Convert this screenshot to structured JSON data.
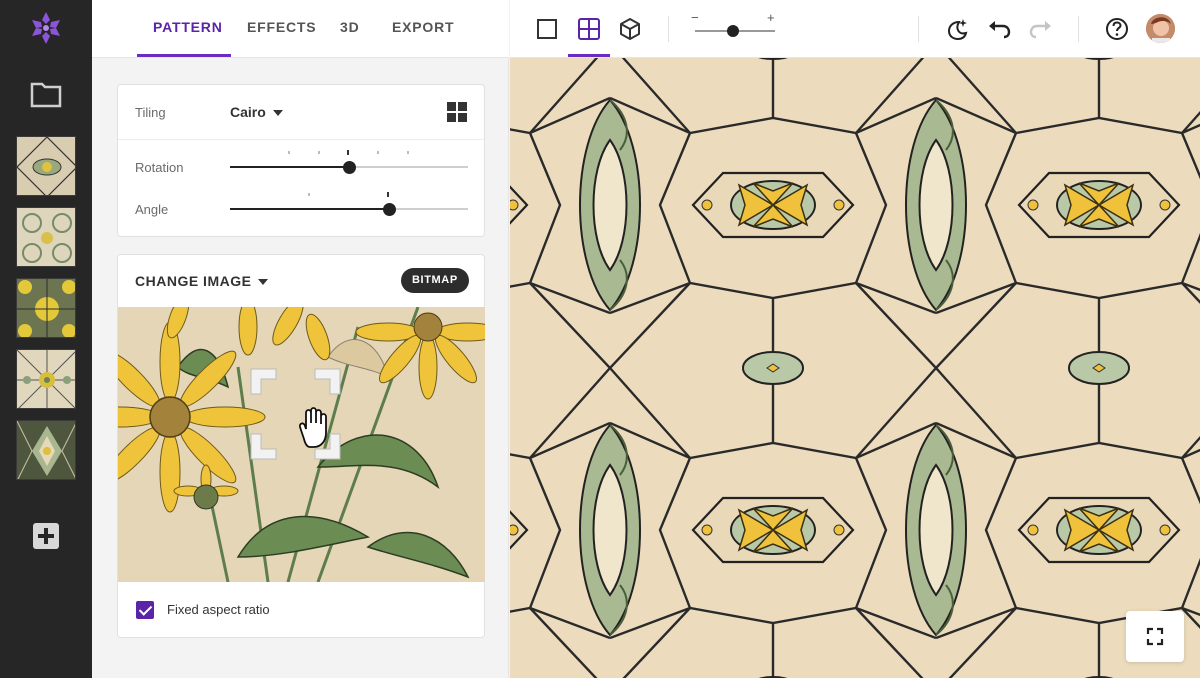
{
  "app": {
    "logo_icon": "asterisk-logo-icon",
    "accent_color": "#5b23a8"
  },
  "sidebar": {
    "folder_icon": "folder-icon",
    "thumbnails": [
      "pattern-1",
      "pattern-2",
      "pattern-3",
      "pattern-4",
      "pattern-5"
    ],
    "add_icon": "plus-icon"
  },
  "tabs": [
    {
      "label": "PATTERN",
      "active": true
    },
    {
      "label": "EFFECTS",
      "active": false
    },
    {
      "label": "3D",
      "active": false
    },
    {
      "label": "EXPORT",
      "active": false
    }
  ],
  "tiling": {
    "label": "Tiling",
    "value": "Cairo",
    "grid_icon": "grid-icon"
  },
  "rotation": {
    "label": "Rotation",
    "value": 0.5
  },
  "angle": {
    "label": "Angle",
    "value": 0.67
  },
  "image_card": {
    "change_label": "CHANGE IMAGE",
    "badge": "BITMAP",
    "fixed_aspect_label": "Fixed aspect ratio",
    "fixed_aspect_checked": true
  },
  "toolbar": {
    "view_buttons": [
      "single-tile-icon",
      "grid-tiles-icon",
      "cube-3d-icon"
    ],
    "active_view": "grid-tiles-icon",
    "zoom_minus": "−",
    "zoom_plus": "+",
    "zoom_level": 0.5,
    "icons": [
      "night-mode-icon",
      "undo-icon",
      "redo-icon",
      "help-icon"
    ]
  }
}
